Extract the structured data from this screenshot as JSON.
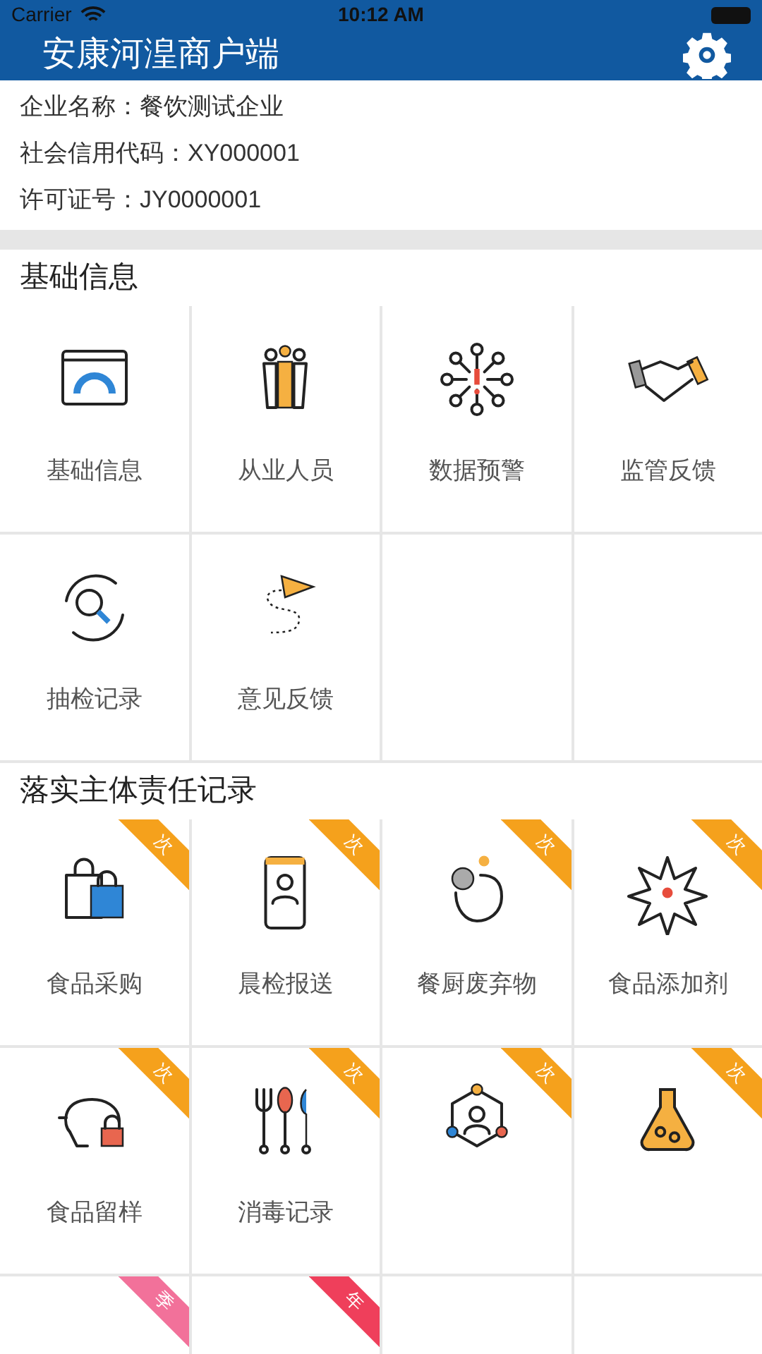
{
  "status_bar": {
    "carrier": "Carrier",
    "time": "10:12 AM"
  },
  "header": {
    "title": "安康河湟商户端"
  },
  "company": [
    {
      "label": "企业名称：",
      "value": "餐饮测试企业"
    },
    {
      "label": "社会信用代码：",
      "value": "XY000001"
    },
    {
      "label": "许可证号：",
      "value": "JY0000001"
    }
  ],
  "sections": [
    {
      "title": "基础信息",
      "items": [
        {
          "label": "基础信息"
        },
        {
          "label": "从业人员"
        },
        {
          "label": "数据预警"
        },
        {
          "label": "监管反馈"
        },
        {
          "label": "抽检记录"
        },
        {
          "label": "意见反馈"
        }
      ]
    },
    {
      "title": "落实主体责任记录",
      "items": [
        {
          "label": "食品采购",
          "badge": "次",
          "color": "#f5a11c"
        },
        {
          "label": "晨检报送",
          "badge": "次",
          "color": "#f5a11c"
        },
        {
          "label": "餐厨废弃物",
          "badge": "次",
          "color": "#f5a11c"
        },
        {
          "label": "食品添加剂",
          "badge": "次",
          "color": "#f5a11c"
        },
        {
          "label": "食品留样",
          "badge": "次",
          "color": "#f5a11c"
        },
        {
          "label": "消毒记录",
          "badge": "次",
          "color": "#f5a11c"
        },
        {
          "badge": "次",
          "color": "#f5a11c"
        },
        {
          "badge": "次",
          "color": "#f5a11c"
        },
        {
          "badge": "季",
          "color": "#f2719a"
        },
        {
          "badge": "年",
          "color": "#ef3f5b"
        }
      ]
    }
  ]
}
